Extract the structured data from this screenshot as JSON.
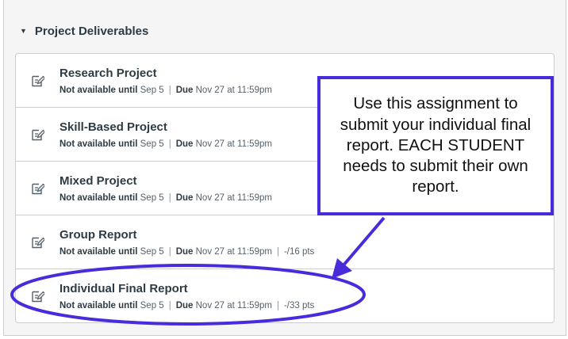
{
  "module": {
    "title": "Project Deliverables",
    "items": [
      {
        "title": "Research Project",
        "not_available_label": "Not available until",
        "not_available_date": "Sep 5",
        "due_label": "Due",
        "due_date": "Nov 27 at 11:59pm",
        "points": ""
      },
      {
        "title": "Skill-Based Project",
        "not_available_label": "Not available until",
        "not_available_date": "Sep 5",
        "due_label": "Due",
        "due_date": "Nov 27 at 11:59pm",
        "points": ""
      },
      {
        "title": "Mixed Project",
        "not_available_label": "Not available until",
        "not_available_date": "Sep 5",
        "due_label": "Due",
        "due_date": "Nov 27 at 11:59pm",
        "points": ""
      },
      {
        "title": "Group Report",
        "not_available_label": "Not available until",
        "not_available_date": "Sep 5",
        "due_label": "Due",
        "due_date": "Nov 27 at 11:59pm",
        "points": "-/16 pts"
      },
      {
        "title": "Individual Final Report",
        "not_available_label": "Not available until",
        "not_available_date": "Sep 5",
        "due_label": "Due",
        "due_date": "Nov 27 at 11:59pm",
        "points": "-/33 pts"
      }
    ]
  },
  "callout": {
    "text": "Use this assignment to submit your individual final report. EACH STUDENT needs to submit their own report."
  },
  "icons": {
    "collapse": "caret-down-icon",
    "assignment": "assignment-icon"
  },
  "colors": {
    "annotation": "#4a2bdc",
    "title_text": "#2d3b45",
    "meta_text": "#55616b"
  }
}
